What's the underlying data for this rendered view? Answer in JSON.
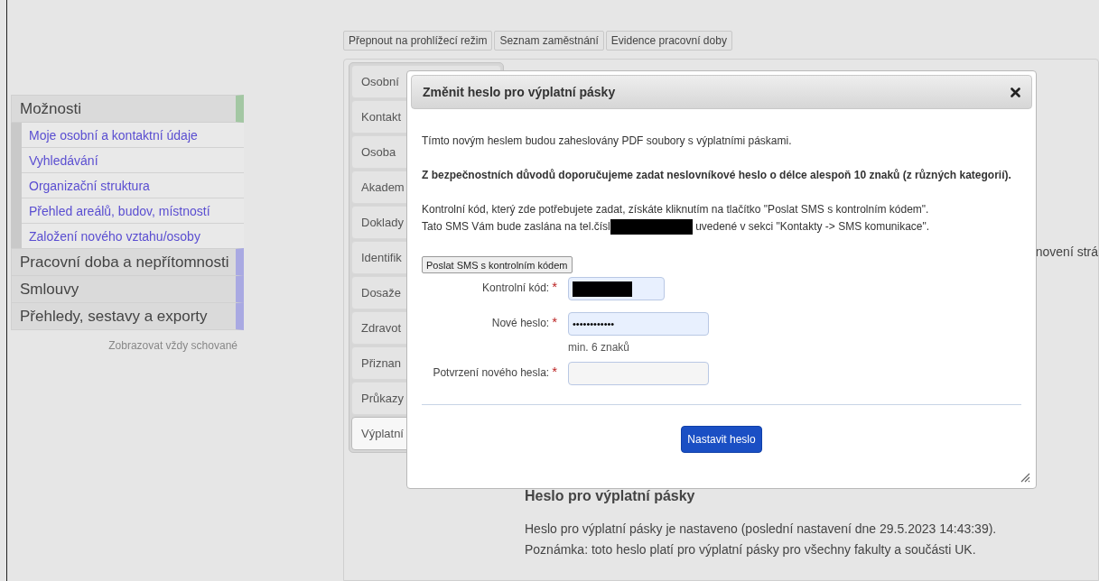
{
  "toolbar": {
    "buttons": [
      {
        "label": "Přepnout na prohlížecí režim"
      },
      {
        "label": "Seznam zaměstnání"
      },
      {
        "label": "Evidence pracovní doby"
      }
    ]
  },
  "sidebar": {
    "sections": [
      {
        "label": "Možnosti",
        "expanded": true,
        "children": [
          {
            "label": "Moje osobní a kontaktní údaje"
          },
          {
            "label": "Vyhledávání"
          },
          {
            "label": "Organizační struktura"
          },
          {
            "label": "Přehled areálů, budov, místností"
          },
          {
            "label": "Založení nového vztahu/osoby"
          }
        ]
      },
      {
        "label": "Pracovní doba a nepřítomnosti",
        "expanded": false
      },
      {
        "label": "Smlouvy",
        "expanded": false
      },
      {
        "label": "Přehledy, sestavy a exporty",
        "expanded": false
      }
    ],
    "footer_link": "Zobrazovat vždy schované"
  },
  "tabs": [
    {
      "label": "Osobní",
      "selected": false
    },
    {
      "label": "Kontakt",
      "selected": false
    },
    {
      "label": "Osoba",
      "selected": false
    },
    {
      "label": "Akadem",
      "selected": false
    },
    {
      "label": "Doklady",
      "selected": false
    },
    {
      "label": "Identifik",
      "selected": false
    },
    {
      "label": "Dosaže",
      "selected": false
    },
    {
      "label": "Zdravot",
      "selected": false
    },
    {
      "label": "Přiznan",
      "selected": false
    },
    {
      "label": "Průkazy",
      "selected": false
    },
    {
      "label": "Výplatní",
      "selected": true
    }
  ],
  "background_fragment": "novení strá",
  "dialog": {
    "title": "Změnit heslo pro výplatní pásky",
    "intro": "Tímto novým heslem budou zaheslovány PDF soubory s výplatními páskami.",
    "warning": "Z bezpečnostních důvodů doporučujeme zadat neslovníkové heslo o délce alespoň 10 znaků (z různých kategorií).",
    "info_line": "Kontrolní kód, který zde potřebujete zadat, získáte kliknutím na tlačítko \"Poslat SMS s kontrolním kódem\".",
    "sms_line_before": "Tato SMS Vám bude zaslána na tel.čísl",
    "sms_line_after": "uvedené v sekci \"Kontakty -> SMS komunikace\".",
    "send_button": "Poslat SMS s kontrolním kódem",
    "fields": [
      {
        "label": "Kontrolní kód:",
        "required_mark": "*",
        "redacted": true,
        "autofilled": true
      },
      {
        "label": "Nové heslo:",
        "required_mark": "*",
        "value": "••••••••••••",
        "autofilled": true,
        "hint": "min. 6 znaků"
      },
      {
        "label": "Potvrzení nového hesla:",
        "required_mark": "*",
        "autofilled": false
      }
    ],
    "submit_button": "Nastavit heslo"
  },
  "status": {
    "heading": "Heslo pro výplatní pásky",
    "lines": [
      "Heslo pro výplatní pásky je nastaveno (poslední nastavení dne 29.5.2023 14:43:39).",
      "Poznámka: toto heslo platí pro výplatní pásky pro všechny fakulty a součásti UK."
    ]
  }
}
